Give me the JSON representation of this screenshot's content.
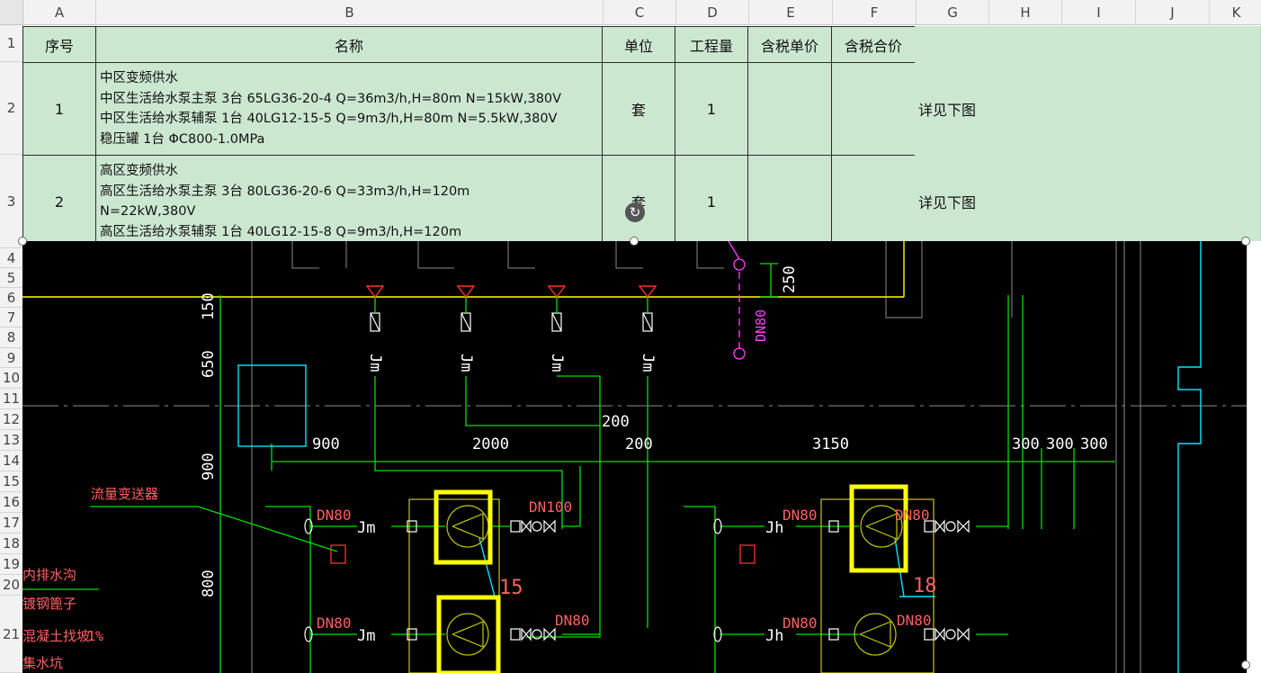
{
  "column_headers": [
    "A",
    "B",
    "C",
    "D",
    "E",
    "F",
    "G",
    "H",
    "I",
    "J",
    "K"
  ],
  "row_headers": [
    "1",
    "2",
    "3",
    "4",
    "5",
    "6",
    "7",
    "8",
    "9",
    "10",
    "11",
    "12",
    "13",
    "14",
    "15",
    "16",
    "17",
    "18",
    "19",
    "20",
    "21"
  ],
  "header_row": {
    "seq": "序号",
    "name": "名称",
    "unit": "单位",
    "quantity": "工程量",
    "unit_price": "含税单价",
    "total_price": "含税合价"
  },
  "rows": [
    {
      "seq": "1",
      "name": "中区变频供水\n中区生活给水泵主泵 3台 65LG36-20-4 Q=36m3/h,H=80m N=15kW,380V\n中区生活给水泵辅泵 1台 40LG12-15-5 Q=9m3/h,H=80m N=5.5kW,380V\n稳压罐 1台 ΦC800-1.0MPa",
      "unit": "套",
      "quantity": "1",
      "note": "详见下图"
    },
    {
      "seq": "2",
      "name": "高区变频供水\n高区生活给水泵主泵 3台 80LG36-20-6 Q=33m3/h,H=120m\nN=22kW,380V\n高区生活给水泵辅泵 1台 40LG12-15-8 Q=9m3/h,H=120m",
      "unit": "套",
      "quantity": "1",
      "note": "详见下图"
    }
  ],
  "rotate_icon": "↻",
  "drawing": {
    "dims_vertical": [
      "150",
      "650",
      "900",
      "800"
    ],
    "dims_horizontal": [
      "900",
      "2000",
      "200",
      "200",
      "3150",
      "300",
      "300",
      "300"
    ],
    "dim_250": "250",
    "labels_dn80": "DN80",
    "label_dn100": "DN100",
    "label_dn80_top": "DN80",
    "flow_transmitter": "流量变送器",
    "jm": "Jm",
    "jh": "Jh",
    "num_15": "15",
    "num_18": "18",
    "left_texts": [
      "内排水沟",
      "镀钢篦子",
      "混凝土找坡",
      "集水坑"
    ],
    "percent": "1%"
  },
  "colors": {
    "green": "#00e000",
    "yellow": "#ffff00",
    "cyan": "#00e5ff",
    "red": "#ff3030",
    "magenta": "#ff40ff",
    "white": "#ffffff",
    "grey": "#8a8a8a",
    "highlight": "#ffff00"
  }
}
